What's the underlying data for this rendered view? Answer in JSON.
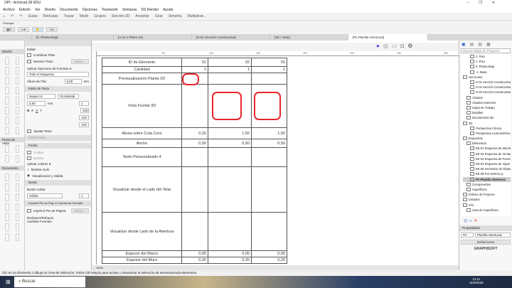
{
  "window": {
    "title": "OPI - Archicad 28 EDU",
    "controls": [
      "–",
      "❐",
      "✕"
    ]
  },
  "menu": [
    "Archivo",
    "Edición",
    "Ver",
    "Diseño",
    "Documento",
    "Opciones",
    "Teamwork",
    "Ventanas",
    "DS Render",
    "Ayuda"
  ],
  "toolbar": {
    "items": [
      "Guías",
      "Retículas",
      "Trazar",
      "Medir",
      "Grupos",
      "Sección 3D",
      "Arrastrar",
      "Girar",
      "Simetría",
      "Multiplicar..."
    ]
  },
  "principal_label": "Principal",
  "tabs": [
    "[0. Planta Baja]",
    "[A.01.1 Plano A3]",
    "[S-01 Sección Constructiva]",
    "[3D / Todo]",
    "[PA Planilla Aberturas]"
  ],
  "toolbox": {
    "sections": [
      "Diseño",
      "Punto de Vista",
      "Documento"
    ]
  },
  "info": {
    "editar": "Editar:",
    "combinar": "Combinar Filas",
    "mostrar_titulo": "Mostrar Título",
    "editar_btn": "Editar...",
    "aplicar_formato": "Aplicar Opciones de Formato a:",
    "aplicar_value": "Todo el Esquema",
    "altura_fila": "Altura de Fila:",
    "altura_value": "6,00",
    "unit": "mm",
    "estilo_texto": "Estilo de Texto",
    "font": "Segoe UI",
    "script": "Occidental",
    "size": "3,50",
    "pen": "1",
    "pct": [
      "100",
      "100",
      "100"
    ],
    "ajustar": "Ajustar Texto",
    "vista_previa": "Vista Previa",
    "fondo": "Fondo",
    "celdas": "Celdas",
    "bordes": "Bordes",
    "aplicar_colores": "Aplicar colores a:",
    "mostrar_solo": "Mostrar Solo",
    "visualizacion": "Visualización y Salida",
    "borde": "Borde",
    "borde_celda": "Borde Celda:",
    "linea": "Sólida",
    "pen2": "1",
    "imprimir_sect": "Imprimir Pie de Pág. & Cambio de Formato",
    "imprimir": "Imprimir Pie de Página",
    "editar2": "Editar...",
    "deshacer": "Deshacer/Rehacer Cambiar Formato"
  },
  "ruler": [
    "50",
    "100",
    "150",
    "200",
    "250",
    "300",
    "350"
  ],
  "schedule": {
    "rows": [
      {
        "label": "ID de Elemento",
        "values": [
          "01",
          "02",
          "03"
        ]
      },
      {
        "label": "Cantidad",
        "values": [
          "1",
          "1",
          "1"
        ]
      },
      {
        "label": "Previsualización Planta 2D",
        "values": [
          "",
          "",
          ""
        ]
      },
      {
        "label": "Vista Frontal 3D",
        "values": [
          "",
          "",
          ""
        ]
      },
      {
        "label": "Altura sobre Cota Cero",
        "values": [
          "0,20",
          "1,55",
          "1,55"
        ]
      },
      {
        "label": "Ancho",
        "values": [
          "0,50",
          "0,50",
          "0,50"
        ]
      },
      {
        "label": "Texto Personalizado  4",
        "values": [
          "",
          "",
          ""
        ]
      },
      {
        "label": "Visualizar desde el Lado del Telar",
        "values": [
          "",
          "",
          ""
        ]
      },
      {
        "label": "Visualizar desde Lado de la Abertura",
        "values": [
          "",
          "",
          ""
        ]
      },
      {
        "label": "Espesor del Marco",
        "values": [
          "0,05",
          "0,05",
          "0,05"
        ]
      },
      {
        "label": "Espesor del Muro",
        "values": [
          "0,30",
          "0,20",
          "0,20"
        ]
      }
    ],
    "annotation_color": "#e8262b"
  },
  "zoom_level": "100%",
  "navigator": {
    "search_placeholder": "Buscar Mapa de Proyecto",
    "items": [
      "2. Piso",
      "1. Piso",
      "0. Planta Baja",
      "-1. Basa",
      "Secciones",
      "S-01 Sección Constructiva",
      "S-02 Sección Constructiva",
      "S-03 Sección Constructiva",
      "Alzados",
      "Alzados Interiores",
      "Hojas de Trabajo",
      "Detalles",
      "Documentos 3D",
      "3D",
      "Perspectiva Cónica",
      "Perspectiva Axonométrica",
      "Esquemas",
      "Elementos",
      "EE-01 Esquema de Muros",
      "EE-02 Esquema de Ventanas",
      "EE-03 Esquema de Puertas",
      "EE-04 Esquema de Vigas",
      "EE-05 Inventario de Objetos",
      "EE-06 Por Defecto p",
      "PA Planilla Aberturas",
      "Componentes",
      "Superficies",
      "Índices de Proyecto",
      "Listados",
      "Info",
      "Lista de Superficies"
    ],
    "propiedades": "Propiedades",
    "prop_id": "PA",
    "prop_name": "Planilla Aberturas",
    "definiciones": "Definiciones",
    "brand": "GRAPHISOFT"
  },
  "status": "Clic en un Elemento o dibuje un Área de Selección. Pulse Ctrl+Mayús para activar o desactivar la selección de elementos/sub-elementos.",
  "taskbar": {
    "search": "Buscar",
    "time": "12:11",
    "date": "11/3/2026"
  }
}
